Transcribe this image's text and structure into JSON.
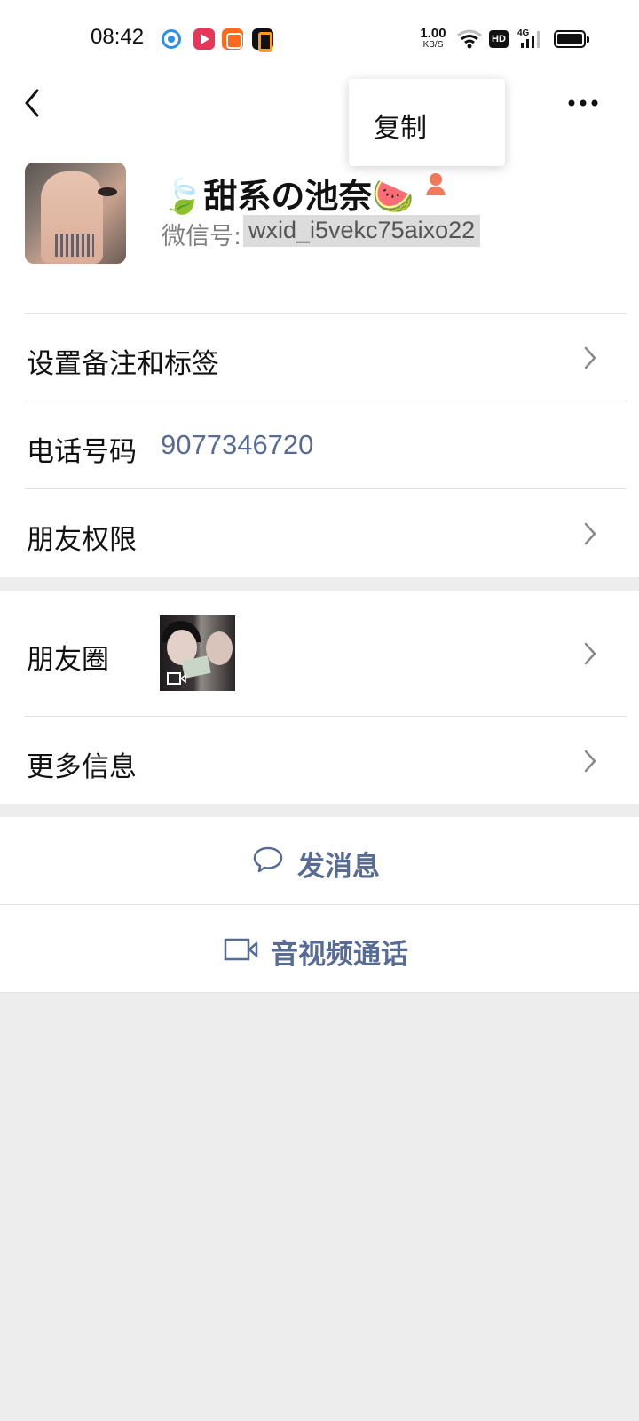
{
  "status_bar": {
    "time": "08:42",
    "net_speed_value": "1.00",
    "net_speed_unit": "KB/S",
    "hd_label": "HD",
    "signal_label": "4G",
    "icons": [
      "browser-app-icon",
      "video-app-icon",
      "camera-app-icon",
      "tv-app-icon",
      "wifi-icon",
      "hd-icon",
      "signal-icon",
      "battery-icon"
    ]
  },
  "nav": {
    "back_icon": "chevron-left-icon",
    "more_icon": "ellipsis-icon"
  },
  "popup": {
    "copy_label": "复制"
  },
  "profile": {
    "nickname": "🍃甜系の池奈🍉",
    "wxid_label": "微信号:",
    "wxid": "wxid_i5vekc75aixo22",
    "gender_icon_color": "#f07a5b"
  },
  "rows": {
    "remark_label": "设置备注和标签",
    "phone_label": "电话号码",
    "phone_value": "9077346720",
    "permissions_label": "朋友权限",
    "moments_label": "朋友圈",
    "more_info_label": "更多信息"
  },
  "actions": {
    "message_label": "发消息",
    "call_label": "音视频通话"
  },
  "colors": {
    "link": "#576b95",
    "background": "#ededed",
    "card": "#ffffff"
  }
}
